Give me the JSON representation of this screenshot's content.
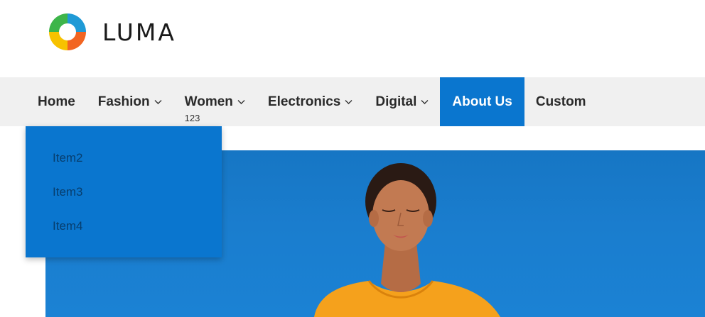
{
  "brand": {
    "name": "LUMA"
  },
  "nav": {
    "items": [
      {
        "label": "Home",
        "has_dropdown": false
      },
      {
        "label": "Fashion",
        "has_dropdown": true
      },
      {
        "label": "Women",
        "has_dropdown": true,
        "sub": "123"
      },
      {
        "label": "Electronics",
        "has_dropdown": true
      },
      {
        "label": "Digital",
        "has_dropdown": true
      },
      {
        "label": "About Us",
        "has_dropdown": false,
        "active": true
      },
      {
        "label": "Custom",
        "has_dropdown": false
      }
    ]
  },
  "dropdown": {
    "items": [
      "Item2",
      "Item3",
      "Item4"
    ]
  },
  "colors": {
    "accent": "#0a76cf",
    "navbar_bg": "#f0f0f0",
    "hero_sky": "#1a7dce",
    "shirt": "#f5a623"
  },
  "icons": [
    "luma-logo-icon",
    "chevron-down-icon"
  ]
}
